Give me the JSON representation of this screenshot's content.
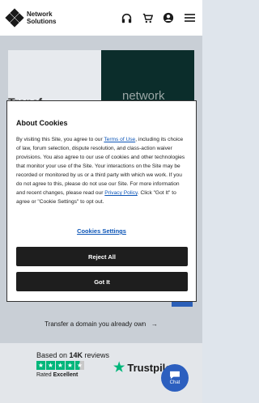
{
  "header": {
    "logo_line1": "Network",
    "logo_line2": "Solutions",
    "icons": [
      "headset-icon",
      "cart-icon",
      "account-icon",
      "menu-icon"
    ]
  },
  "hero": {
    "right_text": "network",
    "left_text": "Transf"
  },
  "transfer_link": "Transfer a domain you already own",
  "reviews": {
    "based_prefix": "Based on ",
    "count": "14K",
    "based_suffix": " reviews",
    "rated_prefix": "Rated ",
    "rating": "Excellent",
    "stars": 4.5,
    "brand": "Trustpilot"
  },
  "chat": {
    "label": "Chat"
  },
  "cookie": {
    "title": "About Cookies",
    "text_1": "By visiting this Site, you agree to our ",
    "terms_link": "Terms of Use",
    "text_2": ", including its choice of law, forum selection, dispute resolution, and class-action waiver provisions. You also agree to our use of cookies and other technologies that monitor your use of the Site. Your interactions on the Site may be recorded or monitored by us or a third party with which we work. If you do not agree to this, please do not use our Site. For more information and recent changes, please read our ",
    "privacy_link": "Privacy Policy",
    "text_3": ". Click \"Got It\" to agree or \"Cookie Settings\" to opt out.",
    "settings_label": "Cookies Settings",
    "reject_label": "Reject All",
    "accept_label": "Got It"
  }
}
